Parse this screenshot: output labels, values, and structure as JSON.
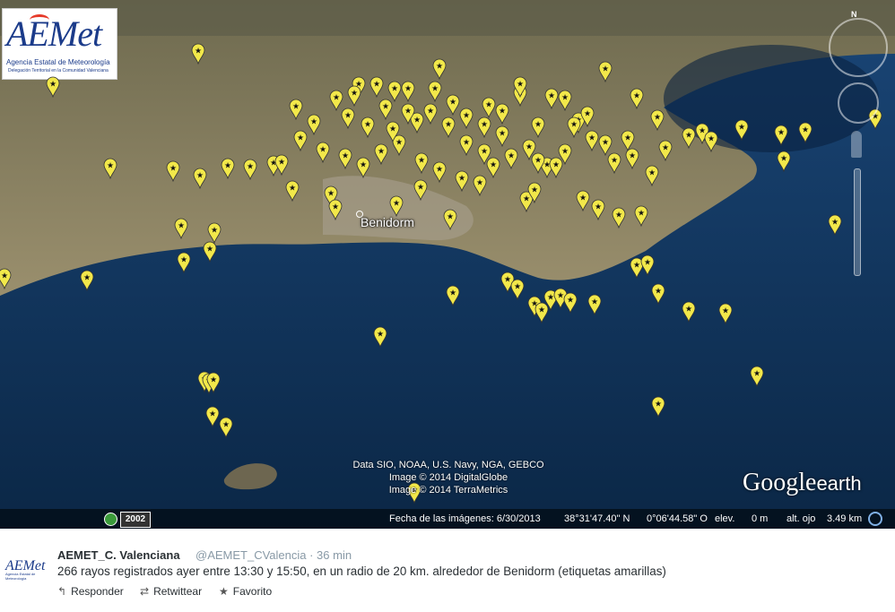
{
  "map": {
    "logo": {
      "brand": "AEMet",
      "agency": "Agencia Estatal de Meteorología",
      "delegation": "Delegación Territorial en la Comunidad Valenciana"
    },
    "city_label": "Benidorm",
    "attribution": [
      "Data SIO, NOAA, U.S. Navy, NGA, GEBCO",
      "Image © 2014 DigitalGlobe",
      "Image © 2014 TerraMetrics"
    ],
    "brand_google": "Google",
    "brand_earth": "earth",
    "compass_label": "N",
    "year_badge": "2002",
    "status": {
      "image_date": "Fecha de las imágenes: 6/30/2013",
      "lat": "38°31'47.40\" N",
      "lon": "0°06'44.58\" O",
      "elev_label": "elev.",
      "elev_value": "0 m",
      "eye_label": "alt. ojo",
      "eye_value": "3.49 km"
    },
    "pin_color": "#f2e84a",
    "sea_color": "#123c6a",
    "land_color": "#8a8263"
  },
  "tweet": {
    "name": "AEMET_C. Valenciana",
    "handle_time": "@AEMET_CValencia · 36 min",
    "text": "266 rayos registrados ayer entre 13:30 y 15:50, en un radio de 20 km. alrededor de Benidorm (etiquetas amarillas)",
    "avatar_brand": "AEMet",
    "avatar_sub": "Agencia Estatal de Meteorología",
    "actions": {
      "reply": "Responder",
      "retweet": "Retwittear",
      "favorite": "Favorito"
    }
  }
}
